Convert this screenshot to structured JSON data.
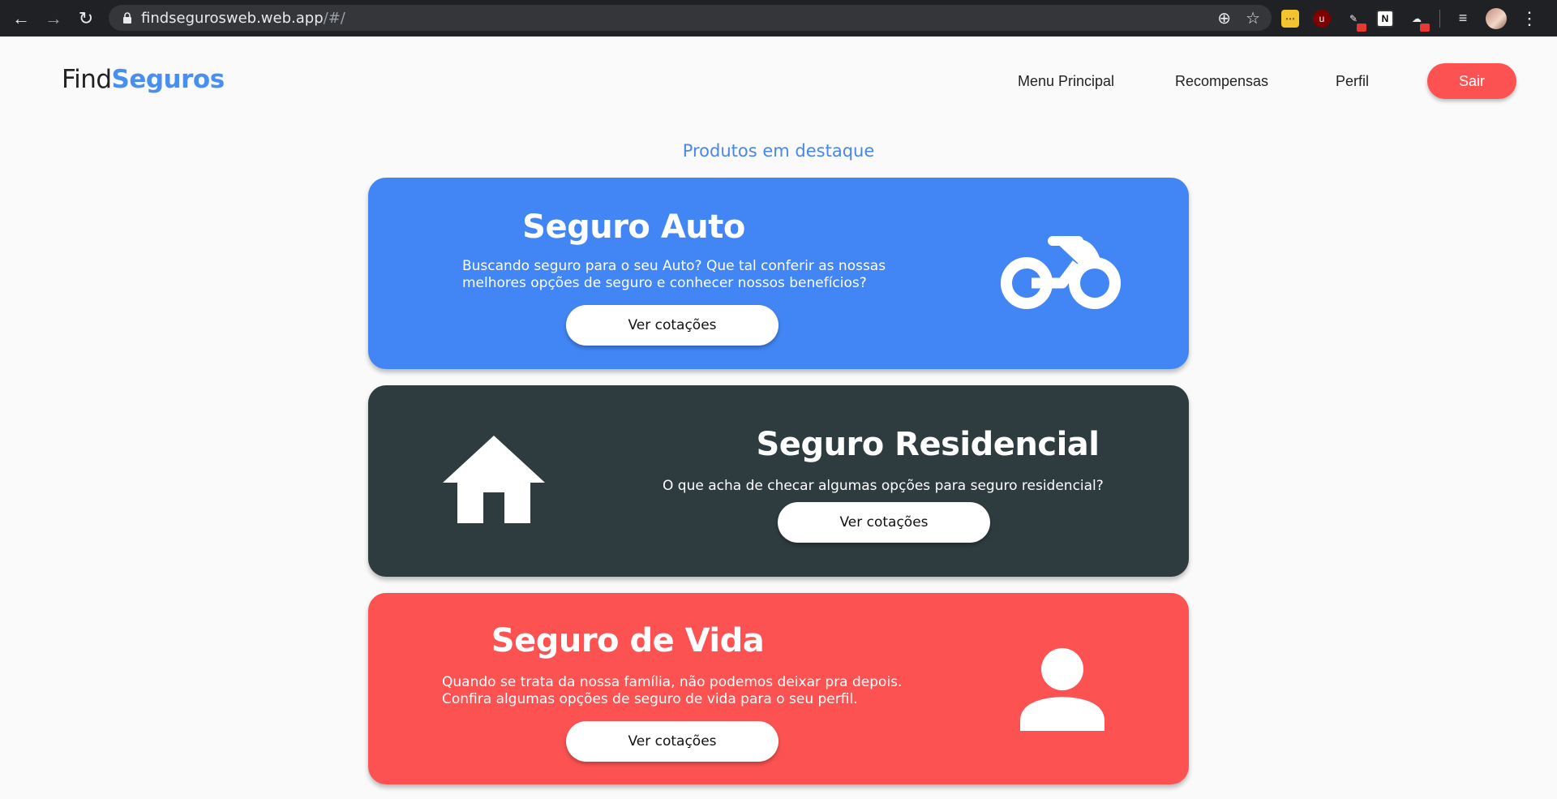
{
  "browser": {
    "url_host": "findsegurosweb.web.app",
    "url_path": "/#/",
    "icons": [
      "back-icon",
      "forward-icon",
      "reload-icon",
      "lock-icon",
      "zoom-icon",
      "bookmark-star-icon"
    ]
  },
  "header": {
    "logo_find": "Find",
    "logo_seguros": "Seguros",
    "nav": [
      "Menu Principal",
      "Recompensas",
      "Perfil"
    ],
    "logout_label": "Sair"
  },
  "main": {
    "section_title": "Produtos em destaque",
    "cards": [
      {
        "title": "Seguro Auto",
        "description_line1": "Buscando seguro para o seu Auto? Que tal conferir as nossas",
        "description_line2": "melhores opções de seguro e conhecer nossos benefícios?",
        "button": "Ver cotações",
        "icon": "motorcycle-icon",
        "color": "#4285f4"
      },
      {
        "title": "Seguro Residencial",
        "description_line1": "O que acha de checar algumas opções para seguro residencial?",
        "button": "Ver cotações",
        "icon": "house-icon",
        "color": "#2e3b3f"
      },
      {
        "title": "Seguro de Vida",
        "description_line1": "Quando se trata da nossa família, não podemos deixar pra depois.",
        "description_line2": "Confira algumas opções de seguro de vida para o seu perfil.",
        "button": "Ver cotações",
        "icon": "person-icon",
        "color": "#fc5252"
      }
    ]
  },
  "colors": {
    "accent_blue": "#4a8ef0",
    "logout_red": "#fc5252",
    "background": "#fafafa"
  }
}
